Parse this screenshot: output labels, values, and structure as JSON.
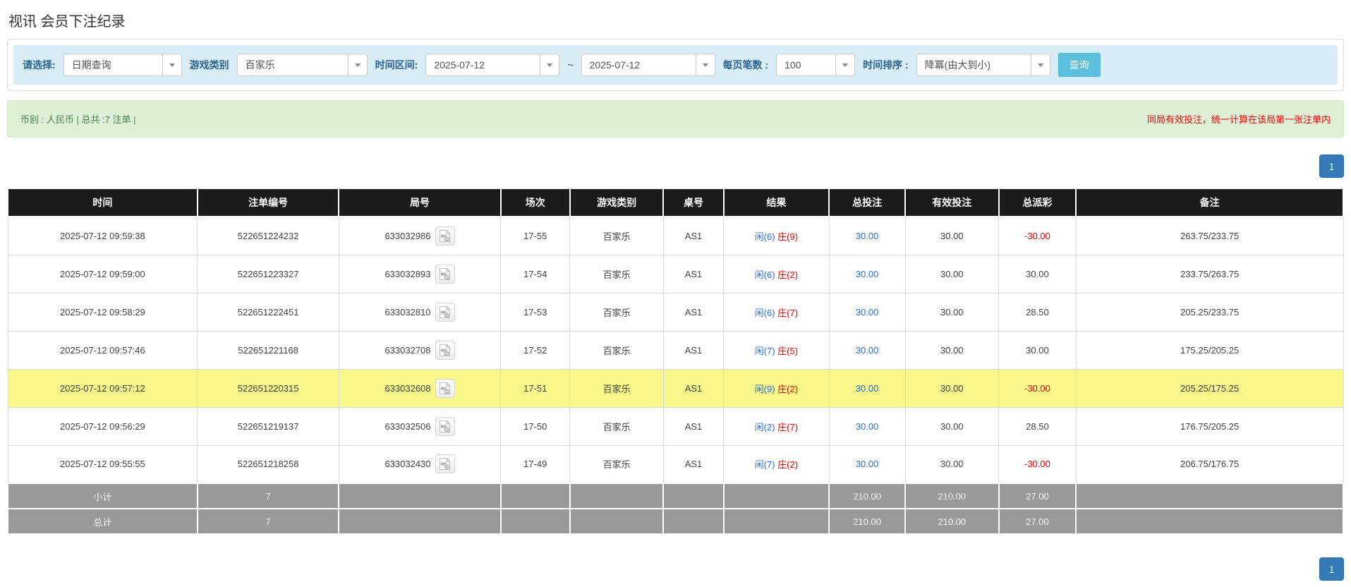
{
  "page": {
    "title": "视讯 会员下注纪录"
  },
  "filters": {
    "query_type_label": "请选择:",
    "query_type_value": "日期查询",
    "game_type_label": "游戏类别",
    "game_type_value": "百家乐",
    "time_range_label": "时间区间:",
    "date_from": "2025-07-12",
    "range_separator": "~",
    "date_to": "2025-07-12",
    "page_size_label": "每页笔数 :",
    "page_size_value": "100",
    "sort_label": "时间排序 :",
    "sort_value": "降冪(由大到小)",
    "search_button": "查询"
  },
  "summary_bar": {
    "left_text": "币别 : 人民币 | 总共 :7 注单 |",
    "right_note": "同局有效投注，统一计算在该局第一张注单内"
  },
  "pagination": {
    "page": "1"
  },
  "table": {
    "columns": [
      "时间",
      "注单编号",
      "局号",
      "场次",
      "游戏类别",
      "桌号",
      "结果",
      "总投注",
      "有效投注",
      "总派彩",
      "备注"
    ],
    "rows": [
      {
        "time": "2025-07-12 09:59:38",
        "bet_id": "522651224232",
        "round_id": "633032986",
        "session": "17-55",
        "game": "百家乐",
        "table_no": "AS1",
        "result_player": "闲(6)",
        "result_banker": "庄(9)",
        "total_bet": "30.00",
        "valid_bet": "30.00",
        "payout": "-30.00",
        "payout_negative": true,
        "remark": "263.75/233.75",
        "highlighted": false
      },
      {
        "time": "2025-07-12 09:59:00",
        "bet_id": "522651223327",
        "round_id": "633032893",
        "session": "17-54",
        "game": "百家乐",
        "table_no": "AS1",
        "result_player": "闲(6)",
        "result_banker": "庄(2)",
        "total_bet": "30.00",
        "valid_bet": "30.00",
        "payout": "30.00",
        "payout_negative": false,
        "remark": "233.75/263.75",
        "highlighted": false
      },
      {
        "time": "2025-07-12 09:58:29",
        "bet_id": "522651222451",
        "round_id": "633032810",
        "session": "17-53",
        "game": "百家乐",
        "table_no": "AS1",
        "result_player": "闲(6)",
        "result_banker": "庄(7)",
        "total_bet": "30.00",
        "valid_bet": "30.00",
        "payout": "28.50",
        "payout_negative": false,
        "remark": "205.25/233.75",
        "highlighted": false
      },
      {
        "time": "2025-07-12 09:57:46",
        "bet_id": "522651221168",
        "round_id": "633032708",
        "session": "17-52",
        "game": "百家乐",
        "table_no": "AS1",
        "result_player": "闲(7)",
        "result_banker": "庄(5)",
        "total_bet": "30.00",
        "valid_bet": "30.00",
        "payout": "30.00",
        "payout_negative": false,
        "remark": "175.25/205.25",
        "highlighted": false
      },
      {
        "time": "2025-07-12 09:57:12",
        "bet_id": "522651220315",
        "round_id": "633032608",
        "session": "17-51",
        "game": "百家乐",
        "table_no": "AS1",
        "result_player": "闲(9)",
        "result_banker": "庄(2)",
        "total_bet": "30.00",
        "valid_bet": "30.00",
        "payout": "-30.00",
        "payout_negative": true,
        "remark": "205.25/175.25",
        "highlighted": true
      },
      {
        "time": "2025-07-12 09:56:29",
        "bet_id": "522651219137",
        "round_id": "633032506",
        "session": "17-50",
        "game": "百家乐",
        "table_no": "AS1",
        "result_player": "闲(2)",
        "result_banker": "庄(7)",
        "total_bet": "30.00",
        "valid_bet": "30.00",
        "payout": "28.50",
        "payout_negative": false,
        "remark": "176.75/205.25",
        "highlighted": false
      },
      {
        "time": "2025-07-12 09:55:55",
        "bet_id": "522651218258",
        "round_id": "633032430",
        "session": "17-49",
        "game": "百家乐",
        "table_no": "AS1",
        "result_player": "闲(7)",
        "result_banker": "庄(2)",
        "total_bet": "30.00",
        "valid_bet": "30.00",
        "payout": "-30.00",
        "payout_negative": true,
        "remark": "206.75/176.75",
        "highlighted": false
      }
    ],
    "summary_rows": [
      {
        "label": "小计",
        "count": "7",
        "total_bet": "210.00",
        "valid_bet": "210.00",
        "payout": "27.00"
      },
      {
        "label": "总计",
        "count": "7",
        "total_bet": "210.00",
        "valid_bet": "210.00",
        "payout": "27.00"
      }
    ]
  },
  "colors": {
    "filter_bg": "#d9edf7",
    "label_blue": "#2a6496",
    "query_btn_blue": "#5bc0de",
    "alert_green_bg": "#dff0d8",
    "alert_green_text": "#468847",
    "note_red": "#ff0000",
    "header_black": "#1b1b1b",
    "highlight_yellow": "#f7f78a",
    "summary_gray": "#999999",
    "pagination_blue": "#337ab7",
    "link_blue": "#2b6fd4",
    "negative_red": "#ee0000"
  }
}
